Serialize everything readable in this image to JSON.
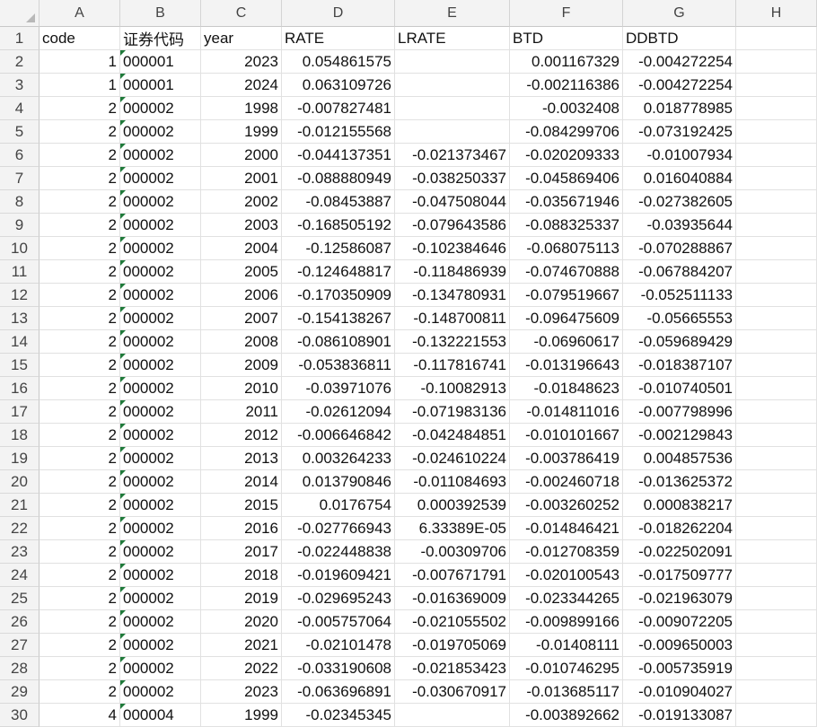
{
  "columns": [
    "A",
    "B",
    "C",
    "D",
    "E",
    "F",
    "G",
    "H"
  ],
  "rows": [
    {
      "n": "1",
      "a": "code",
      "b": "证券代码",
      "c": "year",
      "d": "RATE",
      "e": "LRATE",
      "f": "BTD",
      "g": "DDBTD",
      "header": true
    },
    {
      "n": "2",
      "a": "1",
      "b": "000001",
      "c": "2023",
      "d": "0.054861575",
      "e": "",
      "f": "0.001167329",
      "g": "-0.004272254"
    },
    {
      "n": "3",
      "a": "1",
      "b": "000001",
      "c": "2024",
      "d": "0.063109726",
      "e": "",
      "f": "-0.002116386",
      "g": "-0.004272254"
    },
    {
      "n": "4",
      "a": "2",
      "b": "000002",
      "c": "1998",
      "d": "-0.007827481",
      "e": "",
      "f": "-0.0032408",
      "g": "0.018778985"
    },
    {
      "n": "5",
      "a": "2",
      "b": "000002",
      "c": "1999",
      "d": "-0.012155568",
      "e": "",
      "f": "-0.084299706",
      "g": "-0.073192425"
    },
    {
      "n": "6",
      "a": "2",
      "b": "000002",
      "c": "2000",
      "d": "-0.044137351",
      "e": "-0.021373467",
      "f": "-0.020209333",
      "g": "-0.01007934"
    },
    {
      "n": "7",
      "a": "2",
      "b": "000002",
      "c": "2001",
      "d": "-0.088880949",
      "e": "-0.038250337",
      "f": "-0.045869406",
      "g": "0.016040884"
    },
    {
      "n": "8",
      "a": "2",
      "b": "000002",
      "c": "2002",
      "d": "-0.08453887",
      "e": "-0.047508044",
      "f": "-0.035671946",
      "g": "-0.027382605"
    },
    {
      "n": "9",
      "a": "2",
      "b": "000002",
      "c": "2003",
      "d": "-0.168505192",
      "e": "-0.079643586",
      "f": "-0.088325337",
      "g": "-0.03935644"
    },
    {
      "n": "10",
      "a": "2",
      "b": "000002",
      "c": "2004",
      "d": "-0.12586087",
      "e": "-0.102384646",
      "f": "-0.068075113",
      "g": "-0.070288867"
    },
    {
      "n": "11",
      "a": "2",
      "b": "000002",
      "c": "2005",
      "d": "-0.124648817",
      "e": "-0.118486939",
      "f": "-0.074670888",
      "g": "-0.067884207"
    },
    {
      "n": "12",
      "a": "2",
      "b": "000002",
      "c": "2006",
      "d": "-0.170350909",
      "e": "-0.134780931",
      "f": "-0.079519667",
      "g": "-0.052511133"
    },
    {
      "n": "13",
      "a": "2",
      "b": "000002",
      "c": "2007",
      "d": "-0.154138267",
      "e": "-0.148700811",
      "f": "-0.096475609",
      "g": "-0.05665553"
    },
    {
      "n": "14",
      "a": "2",
      "b": "000002",
      "c": "2008",
      "d": "-0.086108901",
      "e": "-0.132221553",
      "f": "-0.06960617",
      "g": "-0.059689429"
    },
    {
      "n": "15",
      "a": "2",
      "b": "000002",
      "c": "2009",
      "d": "-0.053836811",
      "e": "-0.117816741",
      "f": "-0.013196643",
      "g": "-0.018387107"
    },
    {
      "n": "16",
      "a": "2",
      "b": "000002",
      "c": "2010",
      "d": "-0.03971076",
      "e": "-0.10082913",
      "f": "-0.01848623",
      "g": "-0.010740501"
    },
    {
      "n": "17",
      "a": "2",
      "b": "000002",
      "c": "2011",
      "d": "-0.02612094",
      "e": "-0.071983136",
      "f": "-0.014811016",
      "g": "-0.007798996"
    },
    {
      "n": "18",
      "a": "2",
      "b": "000002",
      "c": "2012",
      "d": "-0.006646842",
      "e": "-0.042484851",
      "f": "-0.010101667",
      "g": "-0.002129843"
    },
    {
      "n": "19",
      "a": "2",
      "b": "000002",
      "c": "2013",
      "d": "0.003264233",
      "e": "-0.024610224",
      "f": "-0.003786419",
      "g": "0.004857536"
    },
    {
      "n": "20",
      "a": "2",
      "b": "000002",
      "c": "2014",
      "d": "0.013790846",
      "e": "-0.011084693",
      "f": "-0.002460718",
      "g": "-0.013625372"
    },
    {
      "n": "21",
      "a": "2",
      "b": "000002",
      "c": "2015",
      "d": "0.0176754",
      "e": "0.000392539",
      "f": "-0.003260252",
      "g": "0.000838217"
    },
    {
      "n": "22",
      "a": "2",
      "b": "000002",
      "c": "2016",
      "d": "-0.027766943",
      "e": "6.33389E-05",
      "f": "-0.014846421",
      "g": "-0.018262204"
    },
    {
      "n": "23",
      "a": "2",
      "b": "000002",
      "c": "2017",
      "d": "-0.022448838",
      "e": "-0.00309706",
      "f": "-0.012708359",
      "g": "-0.022502091"
    },
    {
      "n": "24",
      "a": "2",
      "b": "000002",
      "c": "2018",
      "d": "-0.019609421",
      "e": "-0.007671791",
      "f": "-0.020100543",
      "g": "-0.017509777"
    },
    {
      "n": "25",
      "a": "2",
      "b": "000002",
      "c": "2019",
      "d": "-0.029695243",
      "e": "-0.016369009",
      "f": "-0.023344265",
      "g": "-0.021963079"
    },
    {
      "n": "26",
      "a": "2",
      "b": "000002",
      "c": "2020",
      "d": "-0.005757064",
      "e": "-0.021055502",
      "f": "-0.009899166",
      "g": "-0.009072205"
    },
    {
      "n": "27",
      "a": "2",
      "b": "000002",
      "c": "2021",
      "d": "-0.02101478",
      "e": "-0.019705069",
      "f": "-0.01408111",
      "g": "-0.009650003"
    },
    {
      "n": "28",
      "a": "2",
      "b": "000002",
      "c": "2022",
      "d": "-0.033190608",
      "e": "-0.021853423",
      "f": "-0.010746295",
      "g": "-0.005735919"
    },
    {
      "n": "29",
      "a": "2",
      "b": "000002",
      "c": "2023",
      "d": "-0.063696891",
      "e": "-0.030670917",
      "f": "-0.013685117",
      "g": "-0.010904027"
    },
    {
      "n": "30",
      "a": "4",
      "b": "000004",
      "c": "1999",
      "d": "-0.02345345",
      "e": "",
      "f": "-0.003892662",
      "g": "-0.019133087"
    }
  ],
  "colors": {
    "header_bg": "#f3f3f3",
    "gridline": "#e1e1e1",
    "text_marker": "#1f7a3a"
  }
}
